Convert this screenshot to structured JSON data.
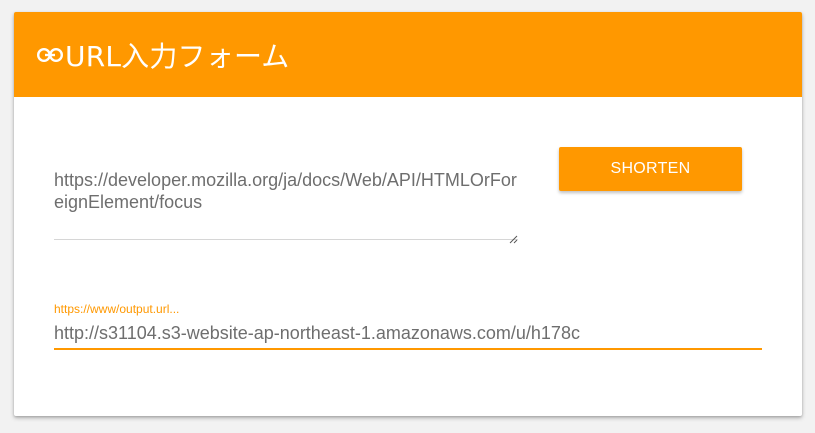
{
  "header": {
    "title": "URL入力フォーム",
    "icon": "link-icon"
  },
  "input": {
    "value": "https://developer.mozilla.org/ja/docs/Web/API/HTMLOrForeignElement/focus"
  },
  "shorten_button": {
    "label": "SHORTEN"
  },
  "output": {
    "label": "https://www/output.url...",
    "value": "http://s31104.s3-website-ap-northeast-1.amazonaws.com/u/h178c"
  },
  "colors": {
    "accent": "#ff9800",
    "text": "#6e6e6e",
    "background": "#f2f2f2",
    "card": "#ffffff"
  }
}
